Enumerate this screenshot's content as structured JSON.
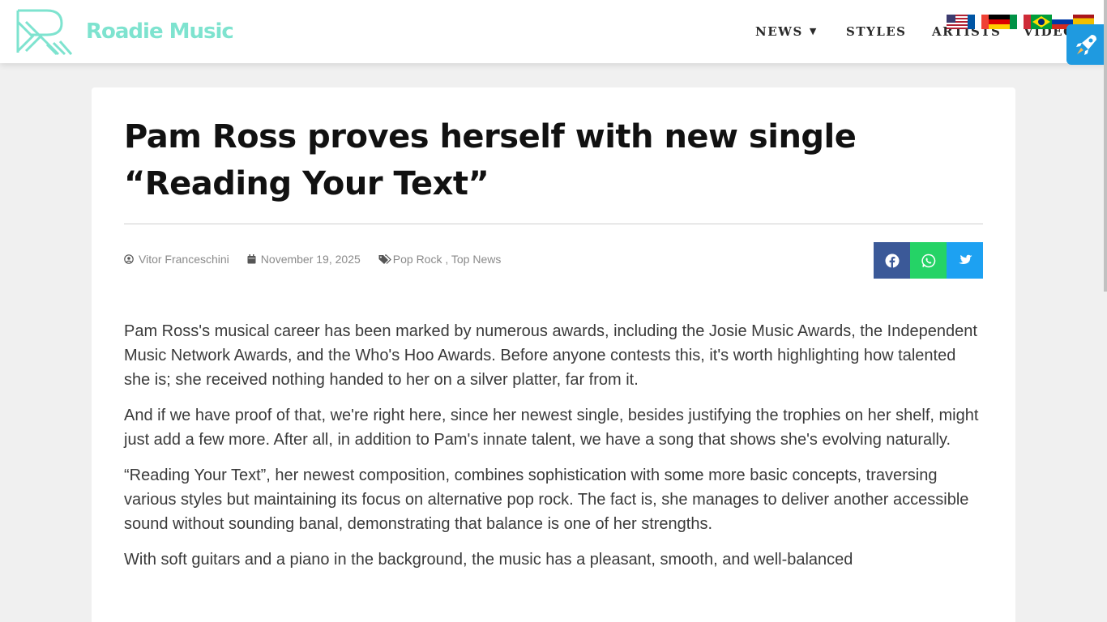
{
  "brand": {
    "name": "Roadie Music",
    "color": "#7ee3cf"
  },
  "nav": {
    "items": [
      {
        "label": "NEWS",
        "has_dropdown": true
      },
      {
        "label": "STYLES"
      },
      {
        "label": "ARTISTS"
      },
      {
        "label": "VIDEO"
      }
    ]
  },
  "languages": [
    "en",
    "fr",
    "de",
    "it",
    "pt-br",
    "ru",
    "es"
  ],
  "article": {
    "title": "Pam Ross proves herself with new single “Reading Your Text”",
    "author": "Vitor Franceschini",
    "date": "November 19, 2025",
    "categories": "Pop Rock , Top News",
    "share": [
      {
        "network": "facebook",
        "color": "#3b5998"
      },
      {
        "network": "whatsapp",
        "color": "#25d366"
      },
      {
        "network": "twitter",
        "color": "#1da1f2"
      }
    ],
    "paragraphs": [
      "Pam Ross's musical career has been marked by numerous awards, including the Josie Music Awards, the Independent Music Network Awards, and the Who's Hoo Awards. Before anyone contests this, it's worth highlighting how talented she is; she received nothing handed to her on a silver platter, far from it.",
      "And if we have proof of that, we're right here, since her newest single, besides justifying the trophies on her shelf, might just add a few more. After all, in addition to Pam's innate talent, we have a song that shows she's evolving naturally.",
      "“Reading Your Text”, her newest composition, combines sophistication with some more basic concepts, traversing various styles but maintaining its focus on alternative pop rock. The fact is, she manages to deliver another accessible sound without sounding banal, demonstrating that balance is one of her strengths.",
      "With soft guitars and a piano in the background, the music has a pleasant, smooth, and well-balanced"
    ]
  }
}
